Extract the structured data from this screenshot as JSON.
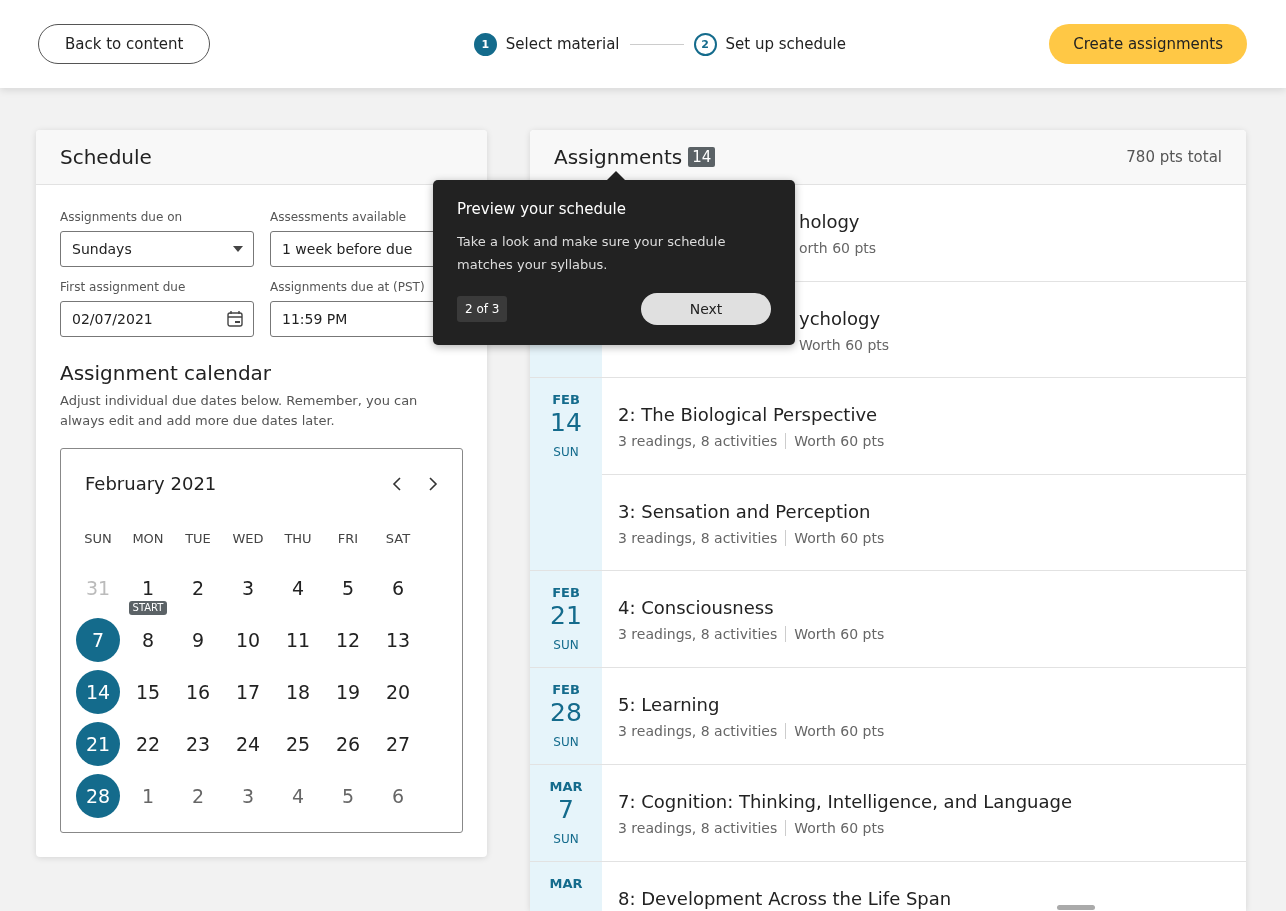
{
  "header": {
    "back_button": "Back to content",
    "steps": [
      {
        "number": "1",
        "label": "Select material",
        "selected": true
      },
      {
        "number": "2",
        "label": "Set up schedule",
        "selected": false
      }
    ],
    "create_button": "Create assignments"
  },
  "schedule": {
    "title": "Schedule",
    "fields": [
      {
        "label": "Assignments due on",
        "value": "Sundays",
        "kind": "select"
      },
      {
        "label": "Assessments available",
        "value": "1 week before due",
        "kind": "text"
      },
      {
        "label": "First assignment due",
        "value": "02/07/2021",
        "kind": "date"
      },
      {
        "label": "Assignments due at (PST)",
        "value": "11:59 PM",
        "kind": "text"
      }
    ],
    "calendar_title": "Assignment calendar",
    "calendar_hint": "Adjust individual due dates below. Remember, you can always edit and add more due dates later.",
    "calendar": {
      "month": "February 2021",
      "weekdays": [
        "SUN",
        "MON",
        "TUE",
        "WED",
        "THU",
        "FRI",
        "SAT"
      ],
      "weeks": [
        [
          {
            "day": "31",
            "outside": true,
            "selected": false
          },
          {
            "day": "1",
            "outside": false,
            "selected": false,
            "badge": "START"
          },
          {
            "day": "2",
            "outside": false,
            "selected": false
          },
          {
            "day": "3",
            "outside": false,
            "selected": false
          },
          {
            "day": "4",
            "outside": false,
            "selected": false
          },
          {
            "day": "5",
            "outside": false,
            "selected": false
          },
          {
            "day": "6",
            "outside": false,
            "selected": false
          }
        ],
        [
          {
            "day": "7",
            "outside": false,
            "selected": true
          },
          {
            "day": "8",
            "outside": false,
            "selected": false
          },
          {
            "day": "9",
            "outside": false,
            "selected": false
          },
          {
            "day": "10",
            "outside": false,
            "selected": false
          },
          {
            "day": "11",
            "outside": false,
            "selected": false
          },
          {
            "day": "12",
            "outside": false,
            "selected": false
          },
          {
            "day": "13",
            "outside": false,
            "selected": false
          }
        ],
        [
          {
            "day": "14",
            "outside": false,
            "selected": true
          },
          {
            "day": "15",
            "outside": false,
            "selected": false
          },
          {
            "day": "16",
            "outside": false,
            "selected": false
          },
          {
            "day": "17",
            "outside": false,
            "selected": false
          },
          {
            "day": "18",
            "outside": false,
            "selected": false
          },
          {
            "day": "19",
            "outside": false,
            "selected": false
          },
          {
            "day": "20",
            "outside": false,
            "selected": false
          }
        ],
        [
          {
            "day": "21",
            "outside": false,
            "selected": true
          },
          {
            "day": "22",
            "outside": false,
            "selected": false
          },
          {
            "day": "23",
            "outside": false,
            "selected": false
          },
          {
            "day": "24",
            "outside": false,
            "selected": false
          },
          {
            "day": "25",
            "outside": false,
            "selected": false
          },
          {
            "day": "26",
            "outside": false,
            "selected": false
          },
          {
            "day": "27",
            "outside": false,
            "selected": false
          }
        ],
        [
          {
            "day": "28",
            "outside": false,
            "selected": true
          },
          {
            "day": "1",
            "outside": true,
            "selected": false
          },
          {
            "day": "2",
            "outside": true,
            "selected": false
          },
          {
            "day": "3",
            "outside": true,
            "selected": false
          },
          {
            "day": "4",
            "outside": true,
            "selected": false
          },
          {
            "day": "5",
            "outside": true,
            "selected": false
          },
          {
            "day": "6",
            "outside": true,
            "selected": false
          }
        ]
      ]
    }
  },
  "assignments": {
    "title": "Assignments",
    "count": "14",
    "total": "780 pts total",
    "groups": [
      {
        "items": [
          {
            "title": "hology",
            "meta": [
              "orth 60 pts"
            ],
            "covered": true
          },
          {
            "title": "ychology",
            "meta": [
              "Worth 60 pts"
            ],
            "covered": true
          }
        ]
      },
      {
        "month": "FEB",
        "day": "14",
        "weekday": "SUN",
        "items": [
          {
            "title": "2: The Biological Perspective",
            "meta": [
              "3 readings, 8 activities",
              "Worth 60 pts"
            ],
            "covered": false
          },
          {
            "title": "3: Sensation and Perception",
            "meta": [
              "3 readings, 8 activities",
              "Worth 60 pts"
            ],
            "covered": false
          }
        ]
      },
      {
        "month": "FEB",
        "day": "21",
        "weekday": "SUN",
        "items": [
          {
            "title": "4: Consciousness",
            "meta": [
              "3 readings, 8 activities",
              "Worth 60 pts"
            ],
            "covered": false
          }
        ]
      },
      {
        "month": "FEB",
        "day": "28",
        "weekday": "SUN",
        "items": [
          {
            "title": "5: Learning",
            "meta": [
              "3 readings, 8 activities",
              "Worth 60 pts"
            ],
            "covered": false
          }
        ]
      },
      {
        "month": "MAR",
        "day": "7",
        "weekday": "SUN",
        "items": [
          {
            "title": "7: Cognition: Thinking, Intelligence, and Language",
            "meta": [
              "3 readings, 8 activities",
              "Worth 60 pts"
            ],
            "covered": false
          }
        ]
      },
      {
        "month": "MAR",
        "items": [
          {
            "title": "8: Development Across the Life Span",
            "covered": false
          }
        ]
      }
    ]
  },
  "tooltip": {
    "title": "Preview your schedule",
    "body": "Take a look and make sure your schedule matches your syllabus.",
    "progress": "2 of 3",
    "next_button": "Next"
  }
}
